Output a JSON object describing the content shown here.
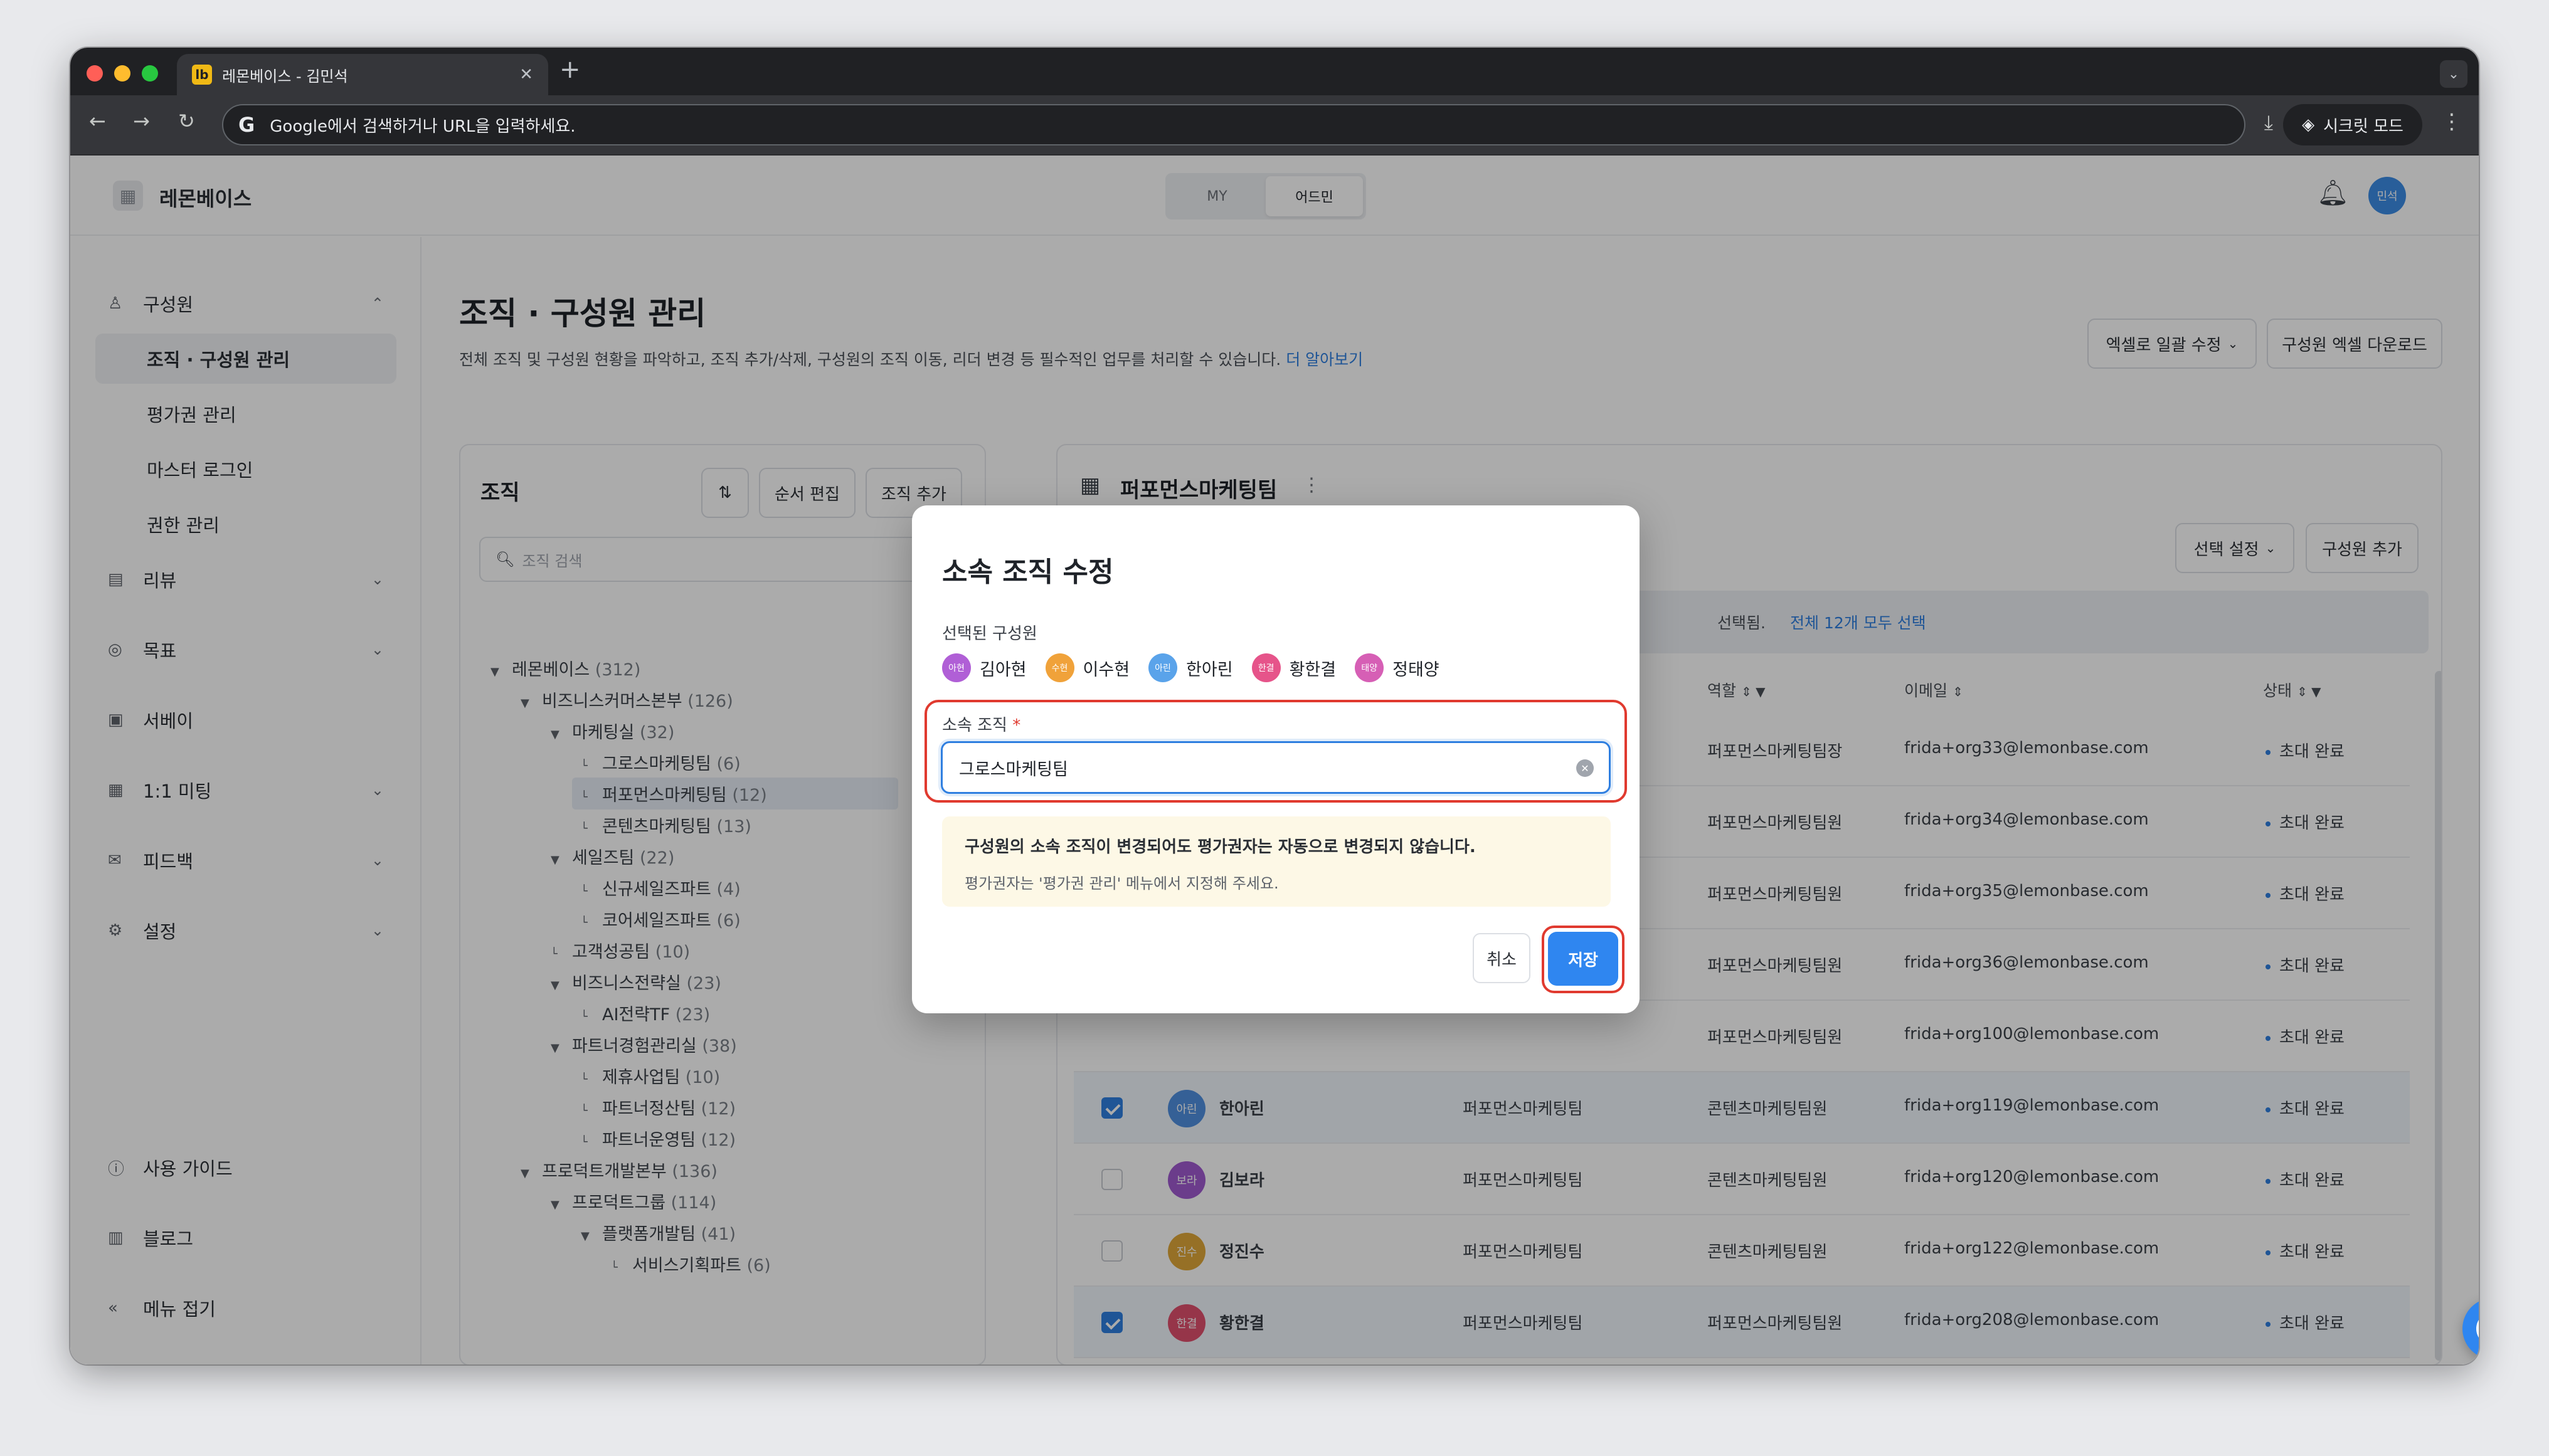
{
  "browser": {
    "tab_title": "레몬베이스 - 김민석",
    "favicon": "lb",
    "address_placeholder": "Google에서 검색하거나 URL을 입력하세요.",
    "incognito_label": "시크릿 모드"
  },
  "header": {
    "logo_text": "레몬베이스",
    "seg_my": "MY",
    "seg_admin": "어드민",
    "avatar": "민석"
  },
  "sidebar": {
    "members": "구성원",
    "sub_org": "조직 · 구성원 관리",
    "sub_eval": "평가권 관리",
    "sub_log": "마스터 로그인",
    "sub_perm": "권한 관리",
    "review": "리뷰",
    "goal": "목표",
    "survey": "서베이",
    "meeting": "1:1 미팅",
    "feedback": "피드백",
    "settings": "설정",
    "guide": "사용 가이드",
    "blog": "블로그",
    "collapse": "메뉴 접기"
  },
  "page": {
    "title": "조직 · 구성원 관리",
    "desc": "전체 조직 및 구성원 현황을 파악하고, 조직 추가/삭제, 구성원의 조직 이동, 리더 변경 등 필수적인 업무를 처리할 수 있습니다.",
    "learn_more": "더 알아보기",
    "excel_edit": "엑셀로 일괄 수정",
    "excel_download": "구성원 엑셀 다운로드"
  },
  "org": {
    "title": "조직",
    "order_edit": "순서 편집",
    "add_org": "조직 추가",
    "search_placeholder": "조직 검색",
    "tree": [
      {
        "name": "레몬베이스",
        "count": "(312)"
      },
      {
        "name": "비즈니스커머스본부",
        "count": "(126)"
      },
      {
        "name": "마케팅실",
        "count": "(32)"
      },
      {
        "name": "그로스마케팅팀",
        "count": "(6)"
      },
      {
        "name": "퍼포먼스마케팅팀",
        "count": "(12)"
      },
      {
        "name": "콘텐츠마케팅팀",
        "count": "(13)"
      },
      {
        "name": "세일즈팀",
        "count": "(22)"
      },
      {
        "name": "신규세일즈파트",
        "count": "(4)"
      },
      {
        "name": "코어세일즈파트",
        "count": "(6)"
      },
      {
        "name": "고객성공팀",
        "count": "(10)"
      },
      {
        "name": "비즈니스전략실",
        "count": "(23)"
      },
      {
        "name": "AI전략TF",
        "count": "(23)"
      },
      {
        "name": "파트너경험관리실",
        "count": "(38)"
      },
      {
        "name": "제휴사업팀",
        "count": "(10)"
      },
      {
        "name": "파트너정산팀",
        "count": "(12)"
      },
      {
        "name": "파트너운영팀",
        "count": "(12)"
      },
      {
        "name": "프로덕트개발본부",
        "count": "(136)"
      },
      {
        "name": "프로덕트그룹",
        "count": "(114)"
      },
      {
        "name": "플랫폼개발팀",
        "count": "(41)"
      },
      {
        "name": "서비스기획파트",
        "count": "(6)"
      }
    ]
  },
  "members": {
    "title": "퍼포먼스마케팅팀",
    "select_setting": "선택 설정",
    "add_member": "구성원 추가",
    "banner_suffix": "선택됨.",
    "banner_link": "전체 12개 모두 선택",
    "col_role": "역할",
    "col_email": "이메일",
    "col_status": "상태",
    "rows": [
      {
        "role": "퍼포먼스마케팅팀장",
        "email": "frida+org33@lemonbase.com",
        "status": "초대 완료"
      },
      {
        "role": "퍼포먼스마케팅팀원",
        "email": "frida+org34@lemonbase.com",
        "status": "초대 완료"
      },
      {
        "role": "퍼포먼스마케팅팀원",
        "email": "frida+org35@lemonbase.com",
        "status": "초대 완료"
      },
      {
        "role": "퍼포먼스마케팅팀원",
        "email": "frida+org36@lemonbase.com",
        "status": "초대 완료"
      },
      {
        "role": "퍼포먼스마케팅팀원",
        "email": "frida+org100@lemonbase.com",
        "status": "초대 완료"
      },
      {
        "avatar": "아린",
        "name": "한아린",
        "org": "퍼포먼스마케팅팀",
        "role": "콘텐츠마케팅팀원",
        "email": "frida+org119@lemonbase.com",
        "status": "초대 완료",
        "checked": true
      },
      {
        "avatar": "보라",
        "name": "김보라",
        "org": "퍼포먼스마케팅팀",
        "role": "콘텐츠마케팅팀원",
        "email": "frida+org120@lemonbase.com",
        "status": "초대 완료",
        "checked": false
      },
      {
        "avatar": "진수",
        "name": "정진수",
        "org": "퍼포먼스마케팅팀",
        "role": "콘텐츠마케팅팀원",
        "email": "frida+org122@lemonbase.com",
        "status": "초대 완료",
        "checked": false
      },
      {
        "avatar": "한결",
        "name": "황한결",
        "org": "퍼포먼스마케팅팀",
        "role": "퍼포먼스마케팅팀원",
        "email": "frida+org208@lemonbase.com",
        "status": "초대 완료",
        "checked": true
      }
    ]
  },
  "modal": {
    "title": "소속 조직 수정",
    "selected_label": "선택된 구성원",
    "chips": [
      {
        "avatar": "아현",
        "name": "김아현",
        "color": "#b05fd6"
      },
      {
        "avatar": "수현",
        "name": "이수현",
        "color": "#f0a23a"
      },
      {
        "avatar": "아린",
        "name": "한아린",
        "color": "#5aa3ea"
      },
      {
        "avatar": "한결",
        "name": "황한결",
        "color": "#e6548a"
      },
      {
        "avatar": "태양",
        "name": "정태양",
        "color": "#d65fb5"
      }
    ],
    "field_label": "소속 조직",
    "required_mark": "*",
    "field_value": "그로스마케팅팀",
    "notice_title": "구성원의 소속 조직이 변경되어도 평가권자는 자동으로 변경되지 않습니다.",
    "notice_body": "평가권자는 '평가권 관리' 메뉴에서 지정해 주세요.",
    "cancel": "취소",
    "save": "저장"
  },
  "colors": {
    "accent": "#2f86f0",
    "highlight": "#e03a2f",
    "notice_bg": "#fdf8e6"
  }
}
